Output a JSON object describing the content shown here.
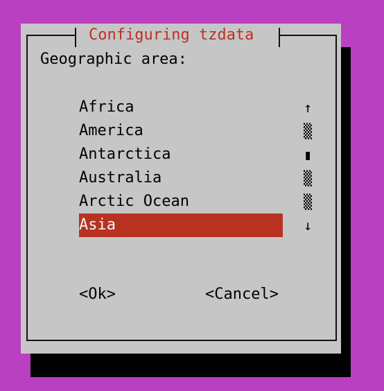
{
  "dialog": {
    "title": "Configuring tzdata",
    "prompt": "Geographic area:"
  },
  "list": {
    "items": [
      "Africa",
      "America",
      "Antarctica",
      "Australia",
      "Arctic Ocean",
      "Asia"
    ],
    "selected": "Asia"
  },
  "scrollbar": {
    "glyphs": [
      "↑",
      "▒",
      "▮",
      "▒",
      "▒",
      "↓"
    ]
  },
  "buttons": {
    "ok": "<Ok>",
    "cancel": "<Cancel>"
  },
  "colors": {
    "terminal_background": "#b940c0",
    "dialog_background": "#c6c6c6",
    "accent": "#b83222"
  }
}
